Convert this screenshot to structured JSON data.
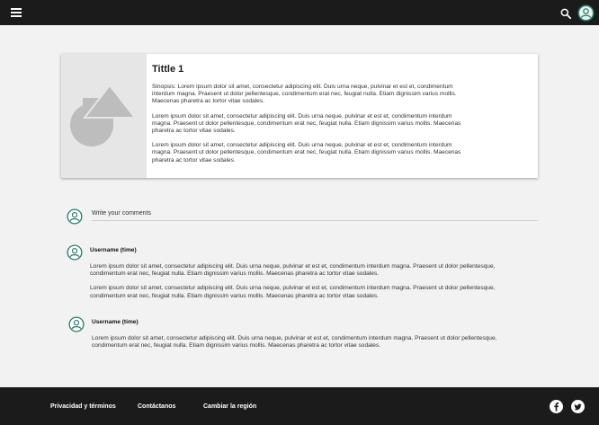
{
  "header": {
    "menu_icon": "menu-icon",
    "search_icon": "search-icon",
    "profile_icon": "account-circle-icon",
    "background": "#1b1b1b"
  },
  "card": {
    "title": "Tittle 1",
    "image_icon": "image-placeholder-icon",
    "paragraphs": [
      "Sinopsis: Lorem ipsum dolor sit amet, consectetur adipiscing elit. Duis urna neque, pulvinar et est et, condimentum interdum magna. Praesent ut dolor pellentesque, condimentum erat nec, feugiat nulla. Etiam dignissim varius mollis. Maecenas pharetra ac tortor vitae sodales.",
      "Lorem ipsum dolor sit amet, consectetur adipiscing elit. Duis urna neque, pulvinar et est et, condimentum interdum magna. Praesent ut dolor pellentesque, condimentum erat nec, feugiat nulla. Etiam dignissim varius mollis. Maecenas pharetra ac tortor vitae sodales.",
      "Lorem ipsum dolor sit amet, consectetur adipiscing elit. Duis urna neque, pulvinar et est et, condimentum interdum magna. Praesent ut dolor pellentesque, condimentum erat nec, feugiat nulla. Etiam dignissim varius mollis. Maecenas pharetra ac tortor vitae sodales."
    ]
  },
  "comment_box": {
    "placeholder": "Write your comments"
  },
  "comments": [
    {
      "user": "Username  (time)",
      "paragraphs": [
        "Lorem ipsum dolor sit amet, consectetur adipiscing elit. Duis urna neque, pulvinar et est et, condimentum interdum magna. Praesent ut dolor pellentesque, condimentum erat nec, feugiat nulla. Etiam dignissim varius mollis. Maecenas pharetra ac tortor vitae sodales.",
        "Lorem ipsum dolor sit amet, consectetur adipiscing elit. Duis urna neque, pulvinar et est et, condimentum interdum magna. Praesent ut dolor pellentesque, condimentum erat nec, feugiat nulla. Etiam dignissim varius mollis. Maecenas pharetra ac tortor vitae sodales."
      ]
    },
    {
      "user": "Username  (time)",
      "paragraphs": [
        "Lorem ipsum dolor sit amet, consectetur adipiscing elit. Duis urna neque, pulvinar et est et, condimentum interdum magna. Praesent ut dolor pellentesque, condimentum erat nec, feugiat nulla. Etiam dignissim varius mollis. Maecenas pharetra ac tortor vitae sodales."
      ]
    }
  ],
  "footer": {
    "links": [
      "Privacidad y términos",
      "Contáctanos",
      "Cambiar la región"
    ],
    "social_icons": [
      "facebook-icon",
      "twitter-icon"
    ]
  },
  "colors": {
    "bars": "#1b1b1b",
    "page_background": "#f2f2f2",
    "avatar_accent": "#2e7d6b"
  }
}
